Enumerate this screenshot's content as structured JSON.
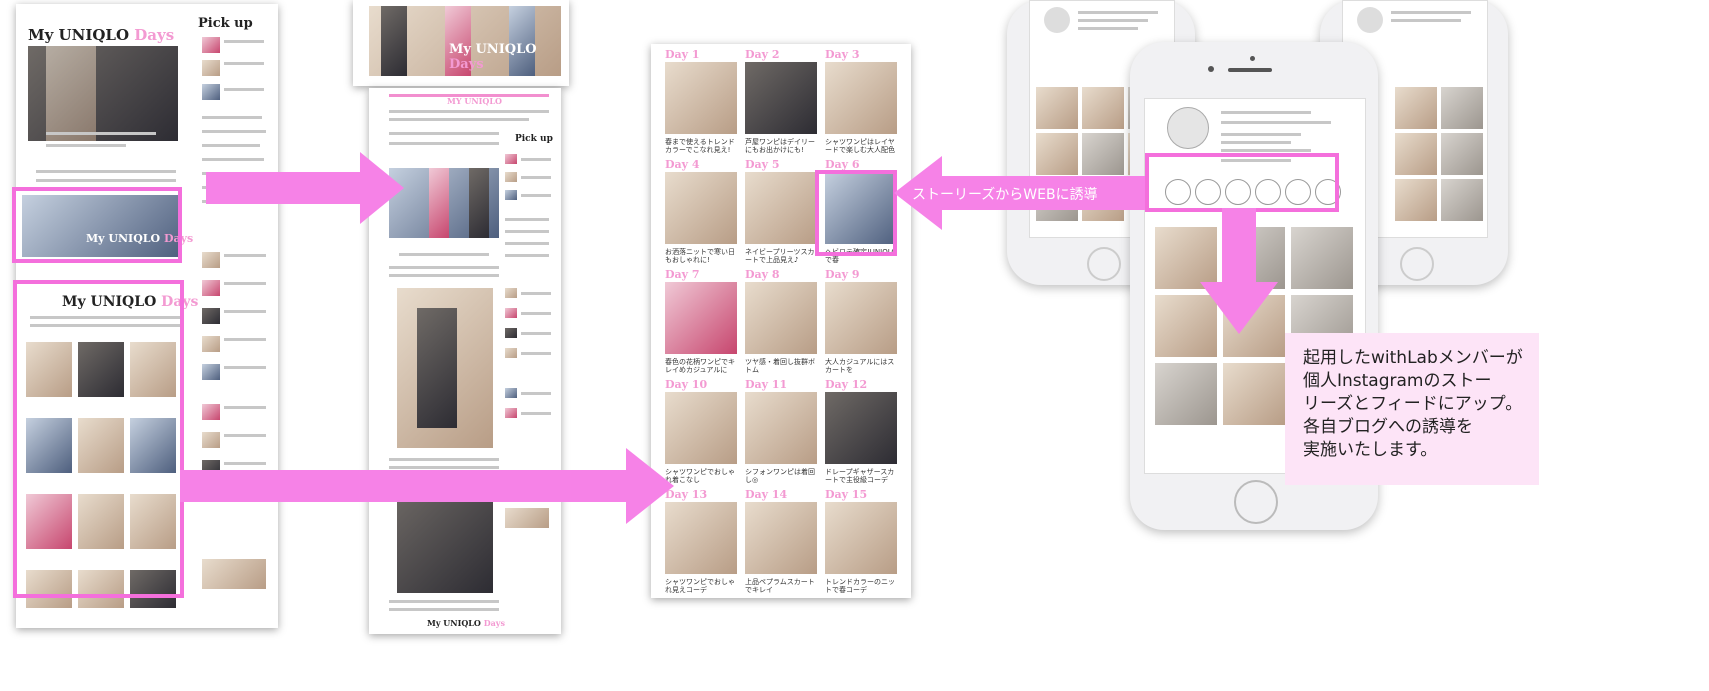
{
  "site": {
    "brand_title": "My UNIQLO",
    "brand_days": "Days",
    "pickup_title": "Pick up",
    "pickup_title_small": "Pick up"
  },
  "callouts": {
    "stories_to_web": "ストーリーズからWEBに誘導",
    "description_lines": [
      "起用したwithLabメンバーが",
      "個人Instagramのストー",
      "リーズとフィードにアップ。",
      "各自ブログへの誘導を",
      "実施いたします。"
    ]
  },
  "days_grid": [
    {
      "label": "Day 1",
      "caption": "春まで使えるトレンドカラーでこなれ見え!"
    },
    {
      "label": "Day 2",
      "caption": "芦屋ワンピはデイリーにもお出かけにも!"
    },
    {
      "label": "Day 3",
      "caption": "シャツワンピはレイヤードで楽しむ大人配色"
    },
    {
      "label": "Day 4",
      "caption": "お洒落ニットで寒い日もおしゃれに!"
    },
    {
      "label": "Day 5",
      "caption": "ネイビープリーツスカートで上品見え♪"
    },
    {
      "label": "Day 6",
      "caption": "ヘビロテ確定!UNIQLOで春"
    },
    {
      "label": "Day 7",
      "caption": "春色の花柄ワンピでキレイめカジュアルに"
    },
    {
      "label": "Day 8",
      "caption": "ツヤ感・着回し抜群ボトム"
    },
    {
      "label": "Day 9",
      "caption": "大人カジュアルにはスカートを"
    },
    {
      "label": "Day 10",
      "caption": "シャツワンピでおしゃれ着こなし"
    },
    {
      "label": "Day 11",
      "caption": "シフォンワンピは着回し◎"
    },
    {
      "label": "Day 12",
      "caption": "ドレープギャザースカートで主役級コーデ"
    },
    {
      "label": "Day 13",
      "caption": "シャツワンピでおしゃれ見えコーデ"
    },
    {
      "label": "Day 14",
      "caption": "上品ペプラムスカートでキレイ"
    },
    {
      "label": "Day 15",
      "caption": "トレンドカラーのニットで春コーデ"
    }
  ]
}
